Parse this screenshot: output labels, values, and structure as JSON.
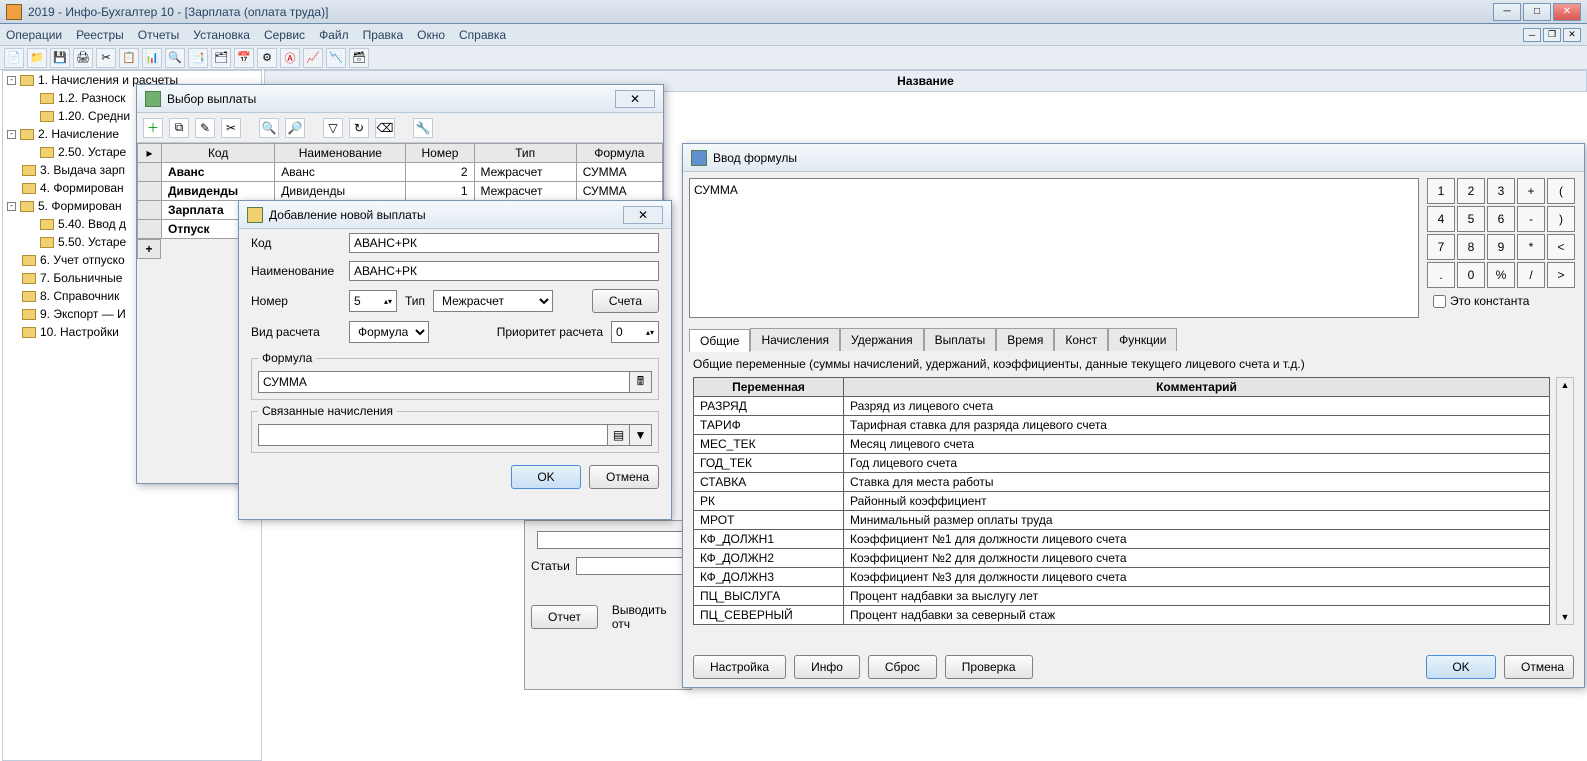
{
  "window": {
    "title": "2019 - Инфо-Бухгалтер 10 - [Зарплата (оплата труда)]"
  },
  "menu": [
    "Операции",
    "Реестры",
    "Отчеты",
    "Установка",
    "Сервис",
    "Файл",
    "Правка",
    "Окно",
    "Справка"
  ],
  "right_header": "Название",
  "tree": [
    {
      "level": 0,
      "toggle": "-",
      "label": "1. Начисления и расчеты"
    },
    {
      "level": 1,
      "toggle": "",
      "label": "1.2. Разноск"
    },
    {
      "level": 1,
      "toggle": "",
      "label": "1.20. Средни"
    },
    {
      "level": 0,
      "toggle": "-",
      "label": "2. Начисление"
    },
    {
      "level": 1,
      "toggle": "",
      "label": "2.50. Устаре"
    },
    {
      "level": 0,
      "toggle": "",
      "label": "3. Выдача зарп"
    },
    {
      "level": 0,
      "toggle": "",
      "label": "4. Формирован"
    },
    {
      "level": 0,
      "toggle": "-",
      "label": "5. Формирован"
    },
    {
      "level": 1,
      "toggle": "",
      "label": "5.40. Ввод д"
    },
    {
      "level": 1,
      "toggle": "",
      "label": "5.50. Устаре"
    },
    {
      "level": 0,
      "toggle": "",
      "label": "6. Учет отпуско"
    },
    {
      "level": 0,
      "toggle": "",
      "label": "7. Больничные"
    },
    {
      "level": 0,
      "toggle": "",
      "label": "8. Справочник"
    },
    {
      "level": 0,
      "toggle": "",
      "label": "9. Экспорт — И"
    },
    {
      "level": 0,
      "toggle": "",
      "label": "10. Настройки"
    }
  ],
  "dlg_select": {
    "title": "Выбор выплаты",
    "cols": [
      "Код",
      "Наименование",
      "Номер",
      "Тип",
      "Формула"
    ],
    "rows": [
      {
        "code": "Аванс",
        "name": "Аванс",
        "num": "2",
        "type": "Межрасчет",
        "formula": "СУММА"
      },
      {
        "code": "Дивиденды",
        "name": "Дивиденды",
        "num": "1",
        "type": "Межрасчет",
        "formula": "СУММА"
      },
      {
        "code": "Зарплата",
        "name": "",
        "num": "",
        "type": "",
        "formula": ""
      },
      {
        "code": "Отпуск",
        "name": "",
        "num": "",
        "type": "",
        "formula": ""
      }
    ]
  },
  "dlg_add": {
    "title": "Добавление новой выплаты",
    "labels": {
      "code": "Код",
      "name": "Наименование",
      "num": "Номер",
      "type": "Тип",
      "accounts": "Счета",
      "calc_kind": "Вид расчета",
      "priority": "Приоритет расчета",
      "formula": "Формула",
      "related": "Связанные начисления",
      "ok": "OK",
      "cancel": "Отмена"
    },
    "values": {
      "code": "АВАНС+РК",
      "name": "АВАНС+РК",
      "num": "5",
      "type": "Межрасчет",
      "calc_kind": "Формула",
      "priority": "0",
      "formula": "СУММА",
      "related": ""
    }
  },
  "partial": {
    "rows": [
      "Статьи"
    ],
    "report_btn": "Отчет",
    "output_label": "Выводить отч"
  },
  "dlg_formula": {
    "title": "Ввод формулы",
    "text": "СУММА",
    "const_label": "Это константа",
    "tabs": [
      "Общие",
      "Начисления",
      "Удержания",
      "Выплаты",
      "Время",
      "Конст",
      "Функции"
    ],
    "tab_desc": "Общие переменные (суммы начислений, удержаний, коэффициенты, данные текущего лицевого счета и т.д.)",
    "var_cols": [
      "Переменная",
      "Комментарий"
    ],
    "vars": [
      {
        "v": "РАЗРЯД",
        "c": "Разряд из лицевого счета"
      },
      {
        "v": "ТАРИФ",
        "c": "Тарифная ставка для разряда лицевого счета"
      },
      {
        "v": "МЕС_ТЕК",
        "c": "Месяц лицевого счета"
      },
      {
        "v": "ГОД_ТЕК",
        "c": "Год лицевого счета"
      },
      {
        "v": "СТАВКА",
        "c": "Ставка для места работы"
      },
      {
        "v": "РК",
        "c": "Районный коэффициент"
      },
      {
        "v": "МРОТ",
        "c": "Минимальный размер оплаты труда"
      },
      {
        "v": "КФ_ДОЛЖН1",
        "c": "Коэффициент №1 для должности лицевого счета"
      },
      {
        "v": "КФ_ДОЛЖН2",
        "c": "Коэффициент №2 для должности лицевого счета"
      },
      {
        "v": "КФ_ДОЛЖН3",
        "c": "Коэффициент №3 для должности лицевого счета"
      },
      {
        "v": "ПЦ_ВЫСЛУГА",
        "c": "Процент надбавки за выслугу лет"
      },
      {
        "v": "ПЦ_СЕВЕРНЫЙ",
        "c": "Процент надбавки за северный стаж"
      }
    ],
    "footer": {
      "settings": "Настройка",
      "info": "Инфо",
      "reset": "Сброс",
      "check": "Проверка",
      "ok": "OK",
      "cancel": "Отмена"
    },
    "keys": [
      "1",
      "2",
      "3",
      "+",
      "(",
      "4",
      "5",
      "6",
      "-",
      ")",
      "7",
      "8",
      "9",
      "*",
      "<",
      ".",
      "0",
      "%",
      "/",
      ">"
    ]
  }
}
